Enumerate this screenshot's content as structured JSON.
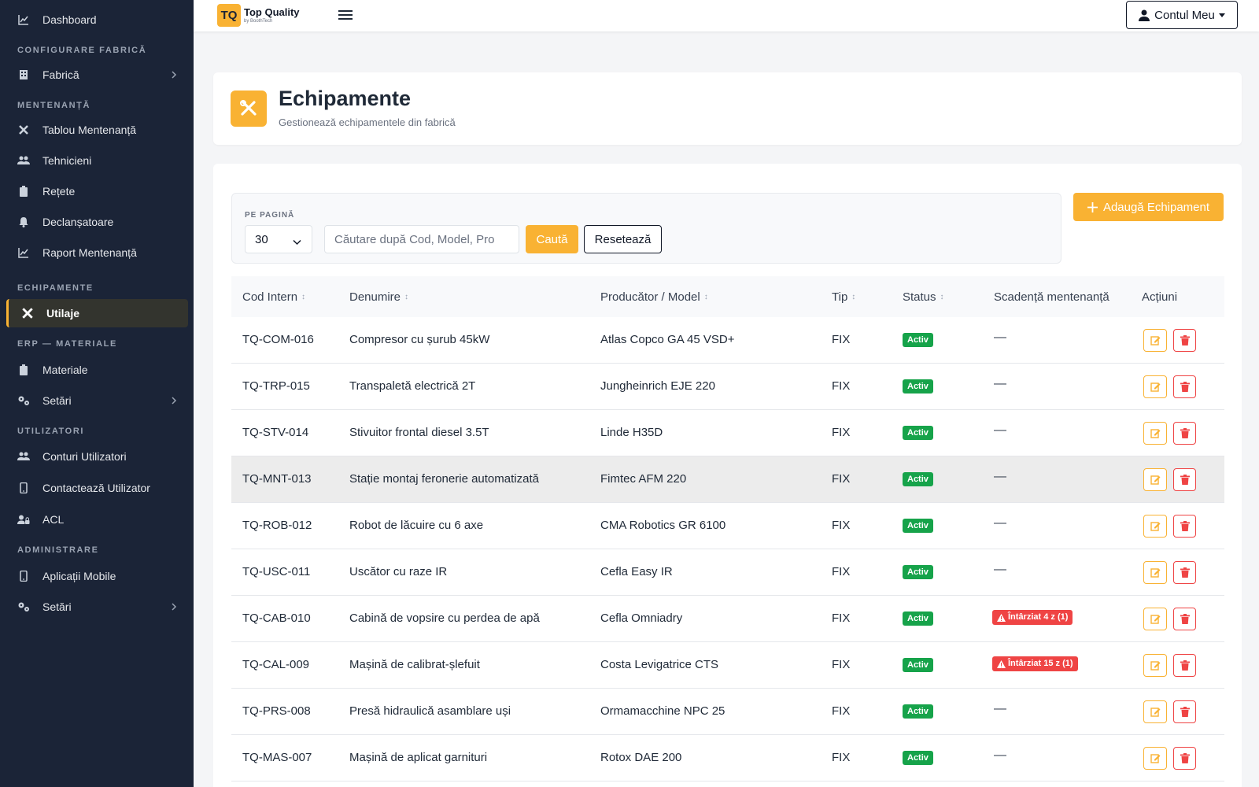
{
  "brand": {
    "logo_mark": "TQ",
    "name": "Top Quality",
    "tagline": "by BoothTech"
  },
  "account": {
    "label": "Contul Meu"
  },
  "colors": {
    "accent": "#f9b233",
    "sidebar_bg": "#1b2437",
    "success": "#16a34a",
    "danger": "#ef4444"
  },
  "sidebar": {
    "dashboard": "Dashboard",
    "sec_config": "CONFIGURARE FABRICĂ",
    "fabrica": "Fabrică",
    "sec_mentenanta": "MENTENANȚĂ",
    "tablou": "Tablou Mentenanță",
    "tehnicieni": "Tehnicieni",
    "retete": "Rețete",
    "declansatoare": "Declanșatoare",
    "raport": "Raport Mentenanță",
    "sec_echipamente": "ECHIPAMENTE",
    "utilaje": "Utilaje",
    "sec_erp": "ERP — MATERIALE",
    "materiale": "Materiale",
    "setari_erp": "Setări",
    "sec_utilizatori": "UTILIZATORI",
    "conturi": "Conturi Utilizatori",
    "contacteaza": "Contactează Utilizator",
    "acl": "ACL",
    "sec_admin": "ADMINISTRARE",
    "aplicatii": "Aplicații Mobile",
    "setari_admin": "Setări"
  },
  "header": {
    "title": "Echipamente",
    "subtitle": "Gestionează echipamentele din fabrică"
  },
  "filters": {
    "per_page_label": "PE PAGINĂ",
    "per_page_value": "30",
    "search_placeholder": "Căutare după Cod, Model, Pro",
    "search_button": "Caută",
    "reset_button": "Resetează",
    "add_button": "Adaugă Echipament"
  },
  "table": {
    "headers": {
      "cod": "Cod Intern",
      "denumire": "Denumire",
      "producator": "Producător / Model",
      "tip": "Tip",
      "status": "Status",
      "scadenta": "Scadență mentenanță",
      "actiuni": "Acțiuni"
    },
    "rows": [
      {
        "cod": "TQ-COM-016",
        "denumire": "Compresor cu șurub 45kW",
        "producator": "Atlas Copco GA 45 VSD+",
        "tip": "FIX",
        "status": "Activ",
        "scadenta": "—",
        "late": false
      },
      {
        "cod": "TQ-TRP-015",
        "denumire": "Transpaletă electrică 2T",
        "producator": "Jungheinrich EJE 220",
        "tip": "FIX",
        "status": "Activ",
        "scadenta": "—",
        "late": false
      },
      {
        "cod": "TQ-STV-014",
        "denumire": "Stivuitor frontal diesel 3.5T",
        "producator": "Linde H35D",
        "tip": "FIX",
        "status": "Activ",
        "scadenta": "—",
        "late": false
      },
      {
        "cod": "TQ-MNT-013",
        "denumire": "Stație montaj feronerie automatizată",
        "producator": "Fimtec AFM 220",
        "tip": "FIX",
        "status": "Activ",
        "scadenta": "—",
        "late": false
      },
      {
        "cod": "TQ-ROB-012",
        "denumire": "Robot de lăcuire cu 6 axe",
        "producator": "CMA Robotics GR 6100",
        "tip": "FIX",
        "status": "Activ",
        "scadenta": "—",
        "late": false
      },
      {
        "cod": "TQ-USC-011",
        "denumire": "Uscător cu raze IR",
        "producator": "Cefla Easy IR",
        "tip": "FIX",
        "status": "Activ",
        "scadenta": "—",
        "late": false
      },
      {
        "cod": "TQ-CAB-010",
        "denumire": "Cabină de vopsire cu perdea de apă",
        "producator": "Cefla Omniadry",
        "tip": "FIX",
        "status": "Activ",
        "scadenta": "Întârziat 4 z (1)",
        "late": true
      },
      {
        "cod": "TQ-CAL-009",
        "denumire": "Mașină de calibrat-șlefuit",
        "producator": "Costa Levigatrice CTS",
        "tip": "FIX",
        "status": "Activ",
        "scadenta": "Întârziat 15 z (1)",
        "late": true
      },
      {
        "cod": "TQ-PRS-008",
        "denumire": "Presă hidraulică asamblare uși",
        "producator": "Ormamacchine NPC 25",
        "tip": "FIX",
        "status": "Activ",
        "scadenta": "—",
        "late": false
      },
      {
        "cod": "TQ-MAS-007",
        "denumire": "Mașină de aplicat garnituri",
        "producator": "Rotox DAE 200",
        "tip": "FIX",
        "status": "Activ",
        "scadenta": "—",
        "late": false
      }
    ]
  }
}
